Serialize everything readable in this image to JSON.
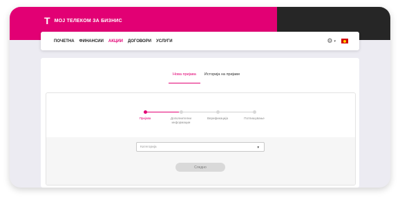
{
  "header": {
    "logo_mark": "T",
    "brand": "МОЈ ТЕЛЕКОМ ЗА БИЗНИС",
    "brand_color": "#e20074",
    "dark_color": "#262626"
  },
  "nav": {
    "items": [
      {
        "label": "ПОЧЕТНА"
      },
      {
        "label": "ФИНАНСИИ"
      },
      {
        "label": "АКЦИИ"
      },
      {
        "label": "ДОГОВОРИ"
      },
      {
        "label": "УСЛУГИ"
      }
    ],
    "active": "АКЦИИ",
    "settings_icon": "gear-icon",
    "language_icon": "macedonia-flag-icon"
  },
  "tabs": [
    {
      "label": "Нова пријава",
      "active": true
    },
    {
      "label": "Историја на пријави",
      "active": false
    }
  ],
  "stepper": {
    "steps": [
      {
        "label": "Пријава",
        "active": true
      },
      {
        "label": "Дополнителни информации",
        "active": false
      },
      {
        "label": "Верификација",
        "active": false
      },
      {
        "label": "Потпишување",
        "active": false
      }
    ]
  },
  "form": {
    "category_placeholder": "Категорија",
    "next_label": "Следно"
  }
}
